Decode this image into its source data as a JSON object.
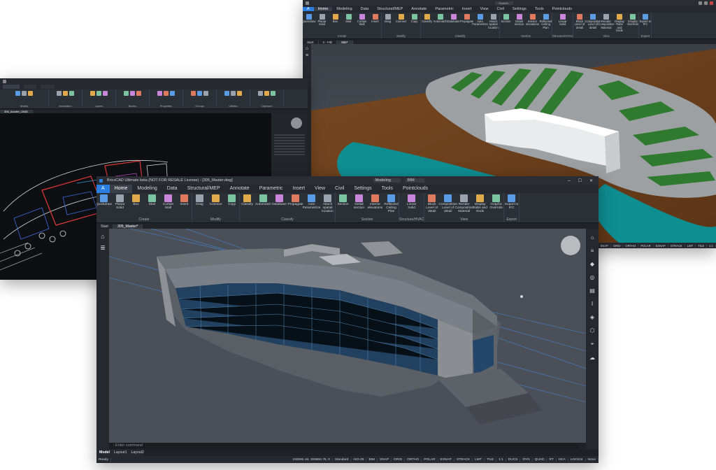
{
  "winA": {
    "menu_tabs": [
      "A",
      "Home",
      "Modeling",
      "Data",
      "Structural/MEP",
      "Annotate",
      "Parametric",
      "Insert",
      "View",
      "Civil",
      "Settings",
      "Tools",
      "Pointclouds"
    ],
    "active_tab": 1,
    "workspace_label": "Modelin",
    "ribbon_groups": [
      {
        "label": "Create",
        "buttons": [
          "Quickdraw",
          "Planar Solid",
          "Box",
          "Stair",
          "Curtain Wall",
          "Insert"
        ]
      },
      {
        "label": "Modify",
        "buttons": [
          "Drag",
          "Connect",
          "Copy"
        ]
      },
      {
        "label": "Classify",
        "buttons": [
          "Classify",
          "Automatch",
          "Database",
          "Propagate",
          "Auto Parametrize",
          "Attach spatial location"
        ]
      },
      {
        "label": "Section",
        "buttons": [
          "Section",
          "Detail section",
          "Interior elevations",
          "Reflected Ceiling Plan"
        ]
      },
      {
        "label": "Structure/HVAC",
        "buttons": [
          "Linear Solid"
        ]
      },
      {
        "label": "View",
        "buttons": [
          "Block Level of detail",
          "Composition Level of detail",
          "Render Composition Material",
          "Display Rabs and Ends",
          "Graphic Override"
        ]
      },
      {
        "label": "Export",
        "buttons": [
          "Export to IFC"
        ]
      }
    ],
    "doc_tabs": [
      "Start",
      "3 - FIB",
      "Site*"
    ],
    "active_doc": 2
  },
  "winB": {
    "doc_tabs": [
      "306_Arcofer_UNID"
    ],
    "ribbon_groups": [
      "Modify",
      "Annotation",
      "Layers",
      "Blocks",
      "Properties",
      "Groups",
      "Utilities",
      "Clipboard"
    ]
  },
  "winC": {
    "title": "BricsCAD Ultimate beta (NOT FOR RESALE License) - [305_Master.dwg]",
    "workspace": "Modeling",
    "visual_style": "BIM",
    "menu_tabs": [
      "A",
      "Home",
      "Modeling",
      "Data",
      "Structural/MEP",
      "Annotate",
      "Parametric",
      "Insert",
      "View",
      "Civil",
      "Settings",
      "Tools",
      "Pointclouds"
    ],
    "active_tab": 1,
    "ribbon_groups": [
      {
        "label": "Create",
        "buttons": [
          "Quickdraw",
          "Planar Solid",
          "Box",
          "Stair",
          "Curtain Wall",
          "Insert"
        ]
      },
      {
        "label": "Modify",
        "buttons": [
          "Drag",
          "Connect",
          "Copy"
        ]
      },
      {
        "label": "Classify",
        "buttons": [
          "Classify",
          "Automatch",
          "Database",
          "Propagate",
          "Auto Parametrize",
          "Attach spatial location"
        ]
      },
      {
        "label": "Section",
        "buttons": [
          "Section",
          "Detail section",
          "Interior elevations",
          "Reflected Ceiling Plan"
        ]
      },
      {
        "label": "Structure/HVAC",
        "buttons": [
          "Linear Solid"
        ]
      },
      {
        "label": "View",
        "buttons": [
          "Block Level of detail",
          "Composition Level of detail",
          "Render Composition Material",
          "Display Rabs and Ends",
          "Graphic Override"
        ]
      },
      {
        "label": "Export",
        "buttons": [
          "Export to IFC"
        ]
      }
    ],
    "doc_tabs": [
      "Start",
      "305_Master*"
    ],
    "active_doc": 1,
    "command_prompt": ": Enter command",
    "layout_tabs": [
      "Model",
      "Layout1",
      "Layout2"
    ],
    "status_prefix": "Ready",
    "coords": "192592.18, 159666.76, 0",
    "status_items": [
      "Standard",
      "ISO-25",
      "BIM",
      "SNAP",
      "GRID",
      "ORTHO",
      "POLAR",
      "ESNAP",
      "STRACK",
      "LWT",
      "TILE",
      "1:1",
      "DUCS",
      "DYN",
      "QUAD",
      "RT",
      "HKA",
      "LOCKUI",
      "None"
    ]
  },
  "colors": {
    "accent": "#3c8ef0",
    "panel": "#2b2f36",
    "viewport": "#4b5058"
  }
}
